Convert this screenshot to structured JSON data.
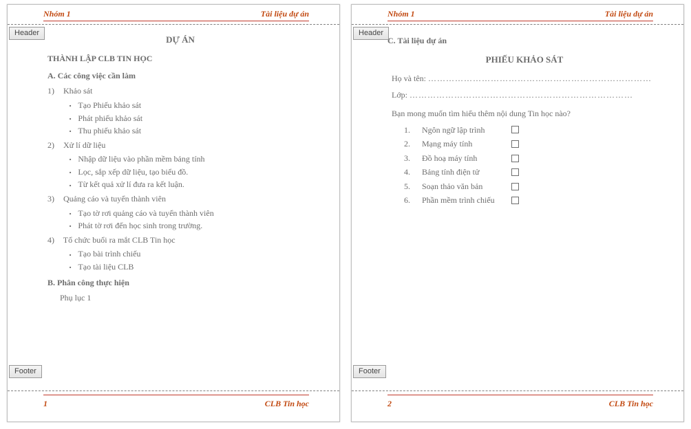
{
  "labels": {
    "header_tab": "Header",
    "footer_tab": "Footer"
  },
  "header": {
    "left": "Nhóm 1",
    "right": "Tài liệu dự án"
  },
  "footer": {
    "page1": "1",
    "page2": "2",
    "right": "CLB Tin học"
  },
  "page1": {
    "project_label": "DỰ ÁN",
    "title": "THÀNH LẬP CLB TIN HỌC",
    "sectionA": "A. Các công việc cần làm",
    "tasks": [
      {
        "num": "1)",
        "name": "Khảo sát",
        "subs": [
          "Tạo Phiếu khảo sát",
          "Phát phiếu khảo sát",
          "Thu phiếu khảo sát"
        ]
      },
      {
        "num": "2)",
        "name": "Xử lí dữ liệu",
        "subs": [
          "Nhập dữ liệu vào phần mềm bảng tính",
          "Lọc, sắp xếp dữ liệu, tạo biểu đồ.",
          "Từ kết quả xử lí đưa ra kết luận."
        ]
      },
      {
        "num": "3)",
        "name": "Quảng cáo và tuyển thành viên",
        "subs": [
          "Tạo tờ rơi quảng cáo và tuyển thành viên",
          "Phát tờ rơi đến học sinh trong trường."
        ]
      },
      {
        "num": "4)",
        "name": "Tổ chức buổi ra mắt CLB Tin học",
        "subs": [
          "Tạo bài trình chiếu",
          "Tạo tài liệu CLB"
        ]
      }
    ],
    "sectionB": "B. Phân công thực hiện",
    "appendix": "Phụ lục 1"
  },
  "page2": {
    "sectionC": "C. Tài liệu dự án",
    "survey_title": "PHIẾU KHẢO SÁT",
    "name_field": "Họ và tên:",
    "class_field": "Lớp:",
    "dots": "…………………………………………………………………",
    "question": "Bạn mong muốn tìm hiểu thêm nội dung Tin học nào?",
    "options": [
      {
        "idx": "1.",
        "text": "Ngôn ngữ lập trình"
      },
      {
        "idx": "2.",
        "text": "Mạng máy tính"
      },
      {
        "idx": "3.",
        "text": "Đồ hoạ máy tính"
      },
      {
        "idx": "4.",
        "text": "Bảng tính điện tử"
      },
      {
        "idx": "5.",
        "text": "Soạn thảo văn bản"
      },
      {
        "idx": "6.",
        "text": "Phần mềm trình chiếu"
      }
    ]
  }
}
